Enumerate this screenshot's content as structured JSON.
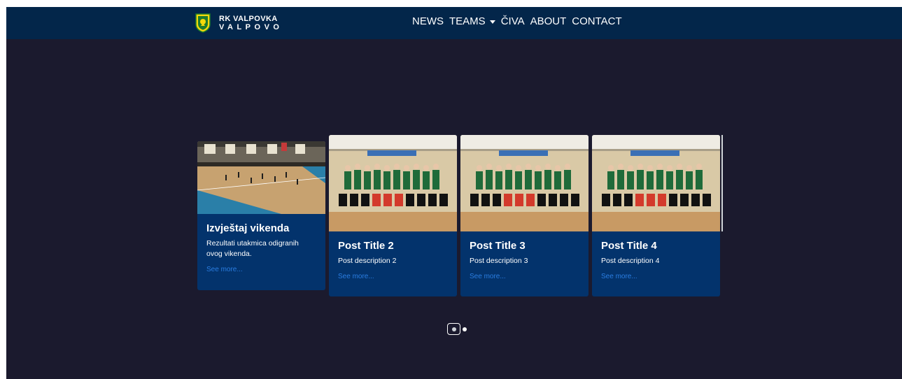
{
  "brand": {
    "line1": "RK VALPOVKA",
    "line2": "VALPOVO",
    "logo_icon": "shield-logo-icon"
  },
  "nav": {
    "news": "NEWS",
    "teams": "TEAMS",
    "civa": "ČIVA",
    "about": "ABOUT",
    "contact": "CONTACT"
  },
  "cards": [
    {
      "title": "Izvještaj vikenda",
      "description": "Rezultati utakmica odigranih ovog vikenda.",
      "link": "See more..."
    },
    {
      "title": "Post Title 2",
      "description": "Post description 2",
      "link": "See more..."
    },
    {
      "title": "Post Title 3",
      "description": "Post description 3",
      "link": "See more..."
    },
    {
      "title": "Post Title 4",
      "description": "Post description 4",
      "link": "See more..."
    }
  ],
  "carousel": {
    "slide_count": 2,
    "active_index": 0
  },
  "colors": {
    "navbar": "#03264a",
    "background": "#1b1a2e",
    "card": "#03336c",
    "link": "#2a7de1"
  }
}
